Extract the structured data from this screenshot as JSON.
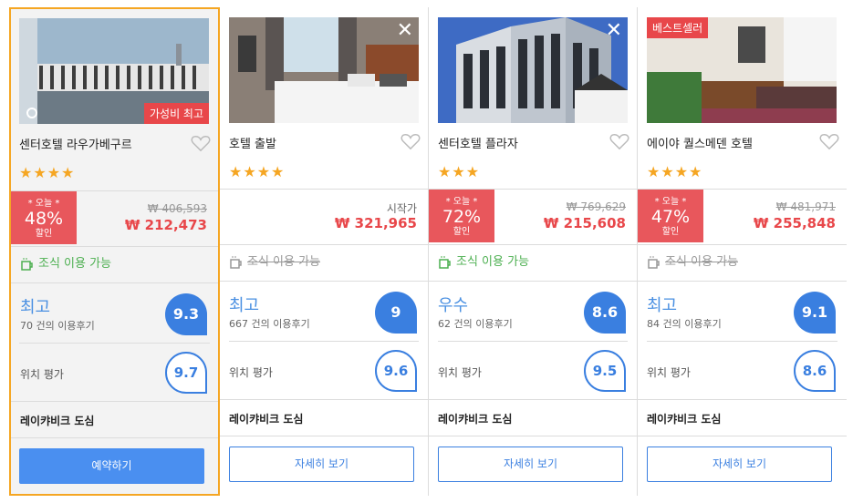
{
  "cards": [
    {
      "name": "센터호텔 라우가베구르",
      "stars": "★★★★",
      "discount": {
        "top": "* 오늘 *",
        "percent": "48%",
        "bottom": "할인"
      },
      "old_price": "₩ 406,593",
      "price": "₩ 212,473",
      "breakfast": "조식 이용 가능",
      "rating_word": "최고",
      "reviews": "70 건의 이용후기",
      "score": "9.3",
      "location_label": "위치 평가",
      "location_score": "9.7",
      "area": "레이캬비크 도심",
      "button": "예약하기",
      "tag": "가성비 최고"
    },
    {
      "name": "호텔 출발",
      "stars": "★★★★",
      "from_label": "시작가",
      "price": "₩ 321,965",
      "breakfast": "조식 이용 가능",
      "rating_word": "최고",
      "reviews": "667 건의 이용후기",
      "score": "9",
      "location_label": "위치 평가",
      "location_score": "9.6",
      "area": "레이캬비크 도심",
      "button": "자세히 보기",
      "close": "✕"
    },
    {
      "name": "센터호텔 플라자",
      "stars": "★★★",
      "discount": {
        "top": "* 오늘 *",
        "percent": "72%",
        "bottom": "할인"
      },
      "old_price": "₩ 769,629",
      "price": "₩ 215,608",
      "breakfast": "조식 이용 가능",
      "rating_word": "우수",
      "reviews": "62 건의 이용후기",
      "score": "8.6",
      "location_label": "위치 평가",
      "location_score": "9.5",
      "area": "레이캬비크 도심",
      "button": "자세히 보기",
      "close": "✕"
    },
    {
      "name": "에이야 퀄스메덴 호텔",
      "stars": "★★★★",
      "discount": {
        "top": "* 오늘 *",
        "percent": "47%",
        "bottom": "할인"
      },
      "old_price": "₩ 481,971",
      "price": "₩ 255,848",
      "breakfast": "조식 이용 가능",
      "rating_word": "최고",
      "reviews": "84 건의 이용후기",
      "score": "9.1",
      "location_label": "위치 평가",
      "location_score": "8.6",
      "area": "레이캬비크 도심",
      "button": "자세히 보기",
      "tag": "베스트셀러"
    }
  ],
  "colors": {
    "accent": "#3a7fe0",
    "discount": "#e8575c",
    "selected_border": "#f5a623",
    "breakfast": "#4caf50"
  }
}
